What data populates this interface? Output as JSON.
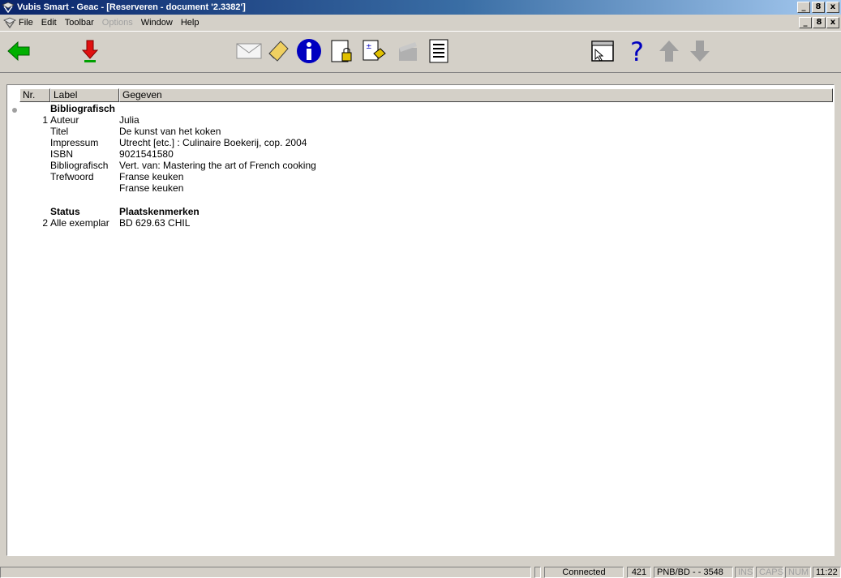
{
  "window": {
    "title": "Vubis Smart - Geac - [Reserveren - document '2.3382']",
    "controls": [
      "_",
      "8",
      "x"
    ]
  },
  "menu": {
    "items": [
      {
        "label": "File",
        "enabled": true
      },
      {
        "label": "Edit",
        "enabled": true
      },
      {
        "label": "Toolbar",
        "enabled": true
      },
      {
        "label": "Options",
        "enabled": false
      },
      {
        "label": "Window",
        "enabled": true
      },
      {
        "label": "Help",
        "enabled": true
      }
    ]
  },
  "toolbar": {
    "icons": [
      "back-arrow-icon",
      "download-arrow-icon",
      "envelope-icon",
      "note-icon",
      "info-icon",
      "lock-document-icon",
      "copy-document-icon",
      "clapperboard-icon",
      "list-document-icon",
      "select-window-icon",
      "help-icon",
      "up-arrow-icon",
      "down-arrow-icon"
    ],
    "colors": {
      "green": "#00a000",
      "red": "#e01010",
      "blue": "#0000c0",
      "gray": "#a0a0a0"
    }
  },
  "table": {
    "columns": [
      "Nr.",
      "Label",
      "Gegeven"
    ],
    "section1": {
      "heading": "Bibliografisch",
      "rows": [
        {
          "nr": "1",
          "label": "Auteur",
          "value": "Julia"
        },
        {
          "nr": "",
          "label": "Titel",
          "value": "De kunst van het koken"
        },
        {
          "nr": "",
          "label": "Impressum",
          "value": "Utrecht [etc.] : Culinaire Boekerij, cop. 2004"
        },
        {
          "nr": "",
          "label": "ISBN",
          "value": "9021541580"
        },
        {
          "nr": "",
          "label": "Bibliografisch",
          "value": "Vert. van: Mastering the art of French cooking"
        },
        {
          "nr": "",
          "label": "Trefwoord",
          "value": "Franse keuken"
        },
        {
          "nr": "",
          "label": "",
          "value": "Franse keuken"
        }
      ]
    },
    "section2": {
      "heading_label": "Status",
      "heading_value": "Plaatskenmerken",
      "rows": [
        {
          "nr": "2",
          "label": "Alle exemplar",
          "value": "BD 629.63 CHIL"
        }
      ]
    }
  },
  "status": {
    "connection": "Connected",
    "code": "421",
    "location": "PNB/BD - - 3548",
    "ins": "INS",
    "caps": "CAPS",
    "num": "NUM",
    "time": "11:22"
  }
}
